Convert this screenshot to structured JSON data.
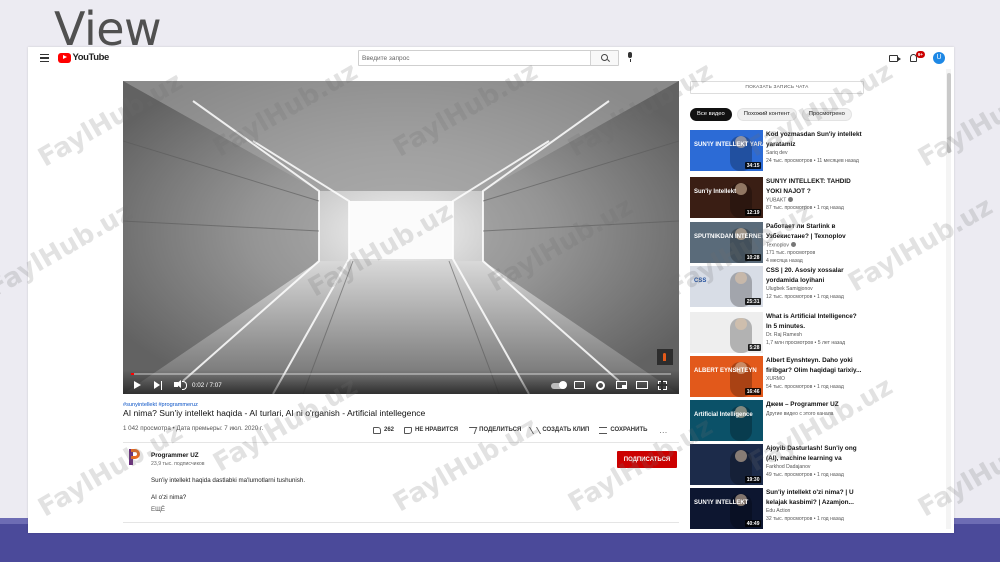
{
  "slide": {
    "title": "View"
  },
  "masthead": {
    "logo_text": "YouTube",
    "search_placeholder": "Введите запрос",
    "notifications_count": "9+",
    "avatar_letter": "U"
  },
  "player": {
    "time": "0:02 / 7:07",
    "progress_fraction": 0.005
  },
  "video": {
    "hashtags": "#sunyintellekt #programmeruz",
    "title": "AI nima? Sun'iy intellekt haqida - AI turlari, AI ni o'rganish - Artificial intellegence",
    "views_line": "1 042 просмотра • Дата премьеры: 7 июл. 2020 г.",
    "actions": {
      "likes": "262",
      "dislike": "НЕ НРАВИТСЯ",
      "share": "ПОДЕЛИТЬСЯ",
      "clip": "СОЗДАТЬ КЛИП",
      "save": "СОХРАНИТЬ",
      "more": "..."
    },
    "channel": {
      "name": "Programmer UZ",
      "subscribers": "23,9 тыс. подписчиков",
      "subscribe_label": "ПОДПИСАТЬСЯ"
    },
    "description": {
      "line1": "Sun'iy intellekt haqida dastlabki ma'lumotlarni tushunish.",
      "line2": "AI o'zi nima?",
      "more": "ЕЩЁ"
    }
  },
  "sidebar": {
    "chat_button": "ПОКАЗАТЬ ЗАПИСЬ ЧАТА",
    "chips": [
      "Все видео",
      "Похожий контент",
      "Просмотрено"
    ],
    "recommendations": [
      {
        "title": "Kod yozmasdan Sun'iy intellekt yaratamiz",
        "channel": "Sariq dev",
        "meta": "24 тыс. просмотров • 11 месяцев назад",
        "meta2": "",
        "duration": "34:15",
        "thumb_label": "SUN'IY INTELLEKT YARATAMIZ",
        "color": "#2c6bd6"
      },
      {
        "title": "SUN'IY INTELLEKT: TAHDID YOKI NAJOT ?",
        "channel": "YUBAKT",
        "meta": "87 тыс. просмотров • 1 год назад",
        "duration": "12:19",
        "thumb_label": "Sun'iy Intellekt",
        "color": "#3a1e14"
      },
      {
        "title": "Работает ли Starlink в Узбекистане? | Texnoplov",
        "channel": "Texnoplov",
        "meta": "171 тыс. просмотров",
        "meta2": "4 месяца назад",
        "duration": "10:28",
        "thumb_label": "SPUTNIKDAN INTERNET",
        "color": "#5a6b7a"
      },
      {
        "title": "CSS | 20. Asosiy xossalar yordamida loyihani yaxshilash...",
        "channel": "Ulugbek Samigjonov",
        "meta": "12 тыс. просмотров • 1 год назад",
        "duration": "25:31",
        "thumb_label": "CSS",
        "color": "#d8dde6"
      },
      {
        "title": "What is Artificial Intelligence? In 5 minutes.",
        "channel": "Dr. Raj Ramesh",
        "meta": "1,7 млн просмотров • 5 лет назад",
        "duration": "5:28",
        "thumb_label": "",
        "color": "#eeeeee"
      },
      {
        "title": "Albert Eynshteyn. Daho yoki firibgar? Olim haqidagi tarixiy...",
        "channel": "XURMO",
        "meta": "54 тыс. просмотров • 1 год назад",
        "duration": "16:46",
        "thumb_label": "ALBERT EYNSHTEYN",
        "color": "#e2591b"
      },
      {
        "title": "Джем – Programmer UZ",
        "channel": "Другие видео с этого канала",
        "meta": "",
        "duration": "",
        "thumb_label": "Artificial Intelligence",
        "color": "#0b5168"
      },
      {
        "title": "Ajoyib Dasturlash! Sun'iy ong (AI), machine learning va deep...",
        "channel": "Farkhod Dadajanov",
        "meta": "49 тыс. просмотров • 1 год назад",
        "duration": "19:30",
        "thumb_label": "",
        "color": "#1c2b4a"
      },
      {
        "title": "Sun'iy intellekt o'zi nima? | U kelajak kasbimi? | Azamjon...",
        "channel": "Edu Action",
        "meta": "32 тыс. просмотров • 1 год назад",
        "duration": "40:49",
        "thumb_label": "SUN'IY INTELLEKT",
        "color": "#0d1630"
      }
    ]
  },
  "watermark_text": "FaylHub.uz"
}
